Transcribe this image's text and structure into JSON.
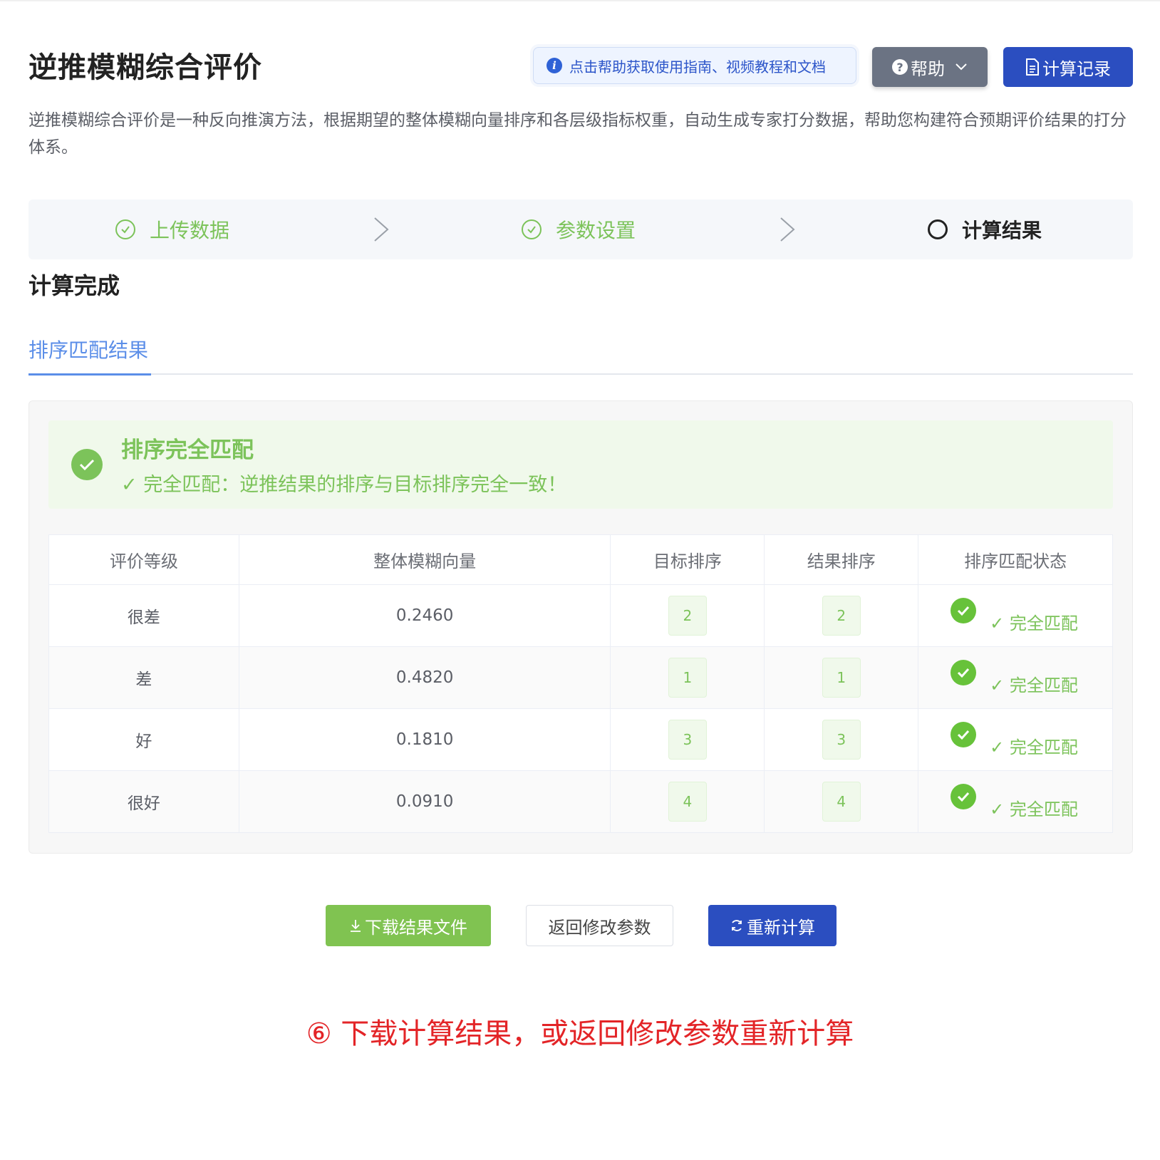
{
  "header": {
    "title": "逆推模糊综合评价",
    "tip": "点击帮助获取使用指南、视频教程和文档",
    "help_label": "帮助",
    "record_label": "计算记录"
  },
  "description": "逆推模糊综合评价是一种反向推演方法，根据期望的整体模糊向量排序和各层级指标权重，自动生成专家打分数据，帮助您构建符合预期评价结果的打分体系。",
  "steps": [
    {
      "label": "上传数据",
      "state": "done"
    },
    {
      "label": "参数设置",
      "state": "done"
    },
    {
      "label": "计算结果",
      "state": "active"
    }
  ],
  "section_title": "计算完成",
  "tab_label": "排序匹配结果",
  "alert": {
    "title": "排序完全匹配",
    "desc": "✓ 完全匹配：逆推结果的排序与目标排序完全一致！"
  },
  "table": {
    "headers": [
      "评价等级",
      "整体模糊向量",
      "目标排序",
      "结果排序",
      "排序匹配状态"
    ],
    "rows": [
      {
        "level": "很差",
        "vector": "0.2460",
        "target": "2",
        "result": "2",
        "status": "✓ 完全匹配"
      },
      {
        "level": "差",
        "vector": "0.4820",
        "target": "1",
        "result": "1",
        "status": "✓ 完全匹配"
      },
      {
        "level": "好",
        "vector": "0.1810",
        "target": "3",
        "result": "3",
        "status": "✓ 完全匹配"
      },
      {
        "level": "很好",
        "vector": "0.0910",
        "target": "4",
        "result": "4",
        "status": "✓ 完全匹配"
      }
    ]
  },
  "actions": {
    "download_label": "下载结果文件",
    "back_label": "返回修改参数",
    "recalc_label": "重新计算"
  },
  "caption": "⑥ 下载计算结果，或返回修改参数重新计算",
  "colors": {
    "primary": "#2b4ec0",
    "success": "#7cc35a",
    "accent_blue": "#5b8ee8",
    "caption_red": "#e32427"
  }
}
